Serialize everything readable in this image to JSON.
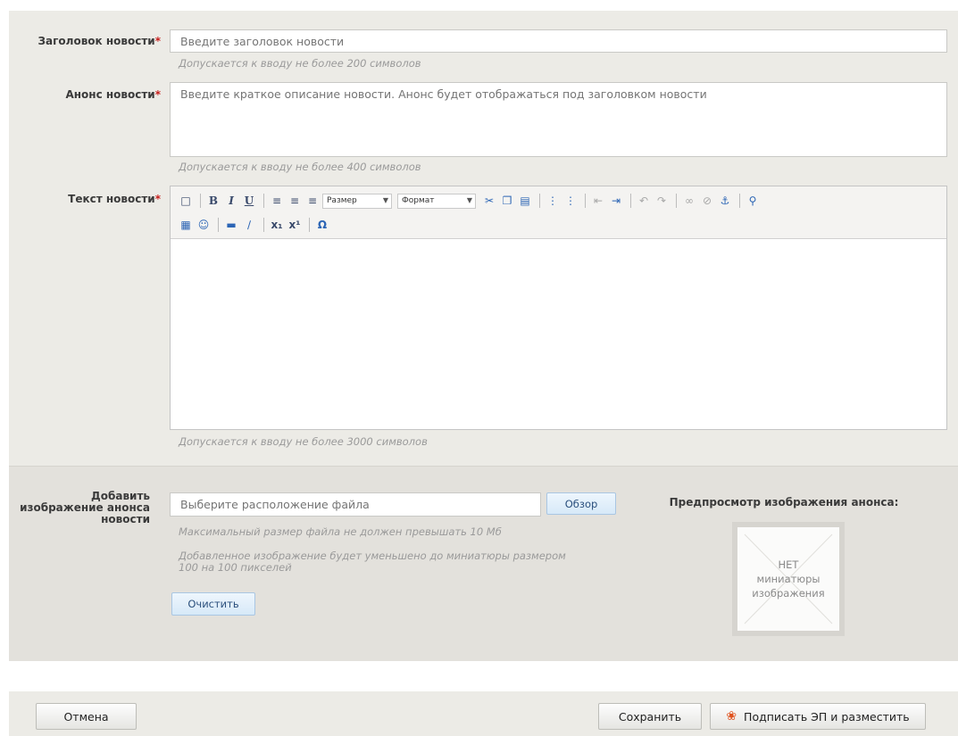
{
  "form": {
    "title_field": {
      "label": "Заголовок новости",
      "required_mark": "*",
      "placeholder": "Введите заголовок новости",
      "hint": "Допускается к вводу не более 200 символов"
    },
    "announce_field": {
      "label": "Анонс новости",
      "required_mark": "*",
      "placeholder": "Введите краткое описание новости. Анонс будет отображаться под заголовком новости",
      "hint": "Допускается к вводу не более 400 символов"
    },
    "text_field": {
      "label": "Текст новости",
      "required_mark": "*",
      "hint": "Допускается к вводу не более 3000 символов",
      "toolbar": {
        "size_select": "Размер",
        "format_select": "Формат",
        "icons": [
          "new-document-icon",
          "bold-icon",
          "italic-icon",
          "underline-icon",
          "align-left-icon",
          "align-center-icon",
          "align-right-icon",
          "cut-icon",
          "copy-icon",
          "paste-icon",
          "bulleted-list-icon",
          "numbered-list-icon",
          "outdent-icon",
          "indent-icon",
          "undo-icon",
          "redo-icon",
          "link-icon",
          "unlink-icon",
          "anchor-icon",
          "find-icon",
          "table-icon",
          "smiley-icon",
          "horizontal-line-icon",
          "remove-format-icon",
          "subscript-icon",
          "superscript-icon",
          "special-char-icon"
        ]
      }
    },
    "image_field": {
      "label": "Добавить изображение анонса новости",
      "placeholder": "Выберите расположение файла",
      "browse_button": "Обзор",
      "hint_size": "Максимальный размер файла не должен превышать 10 Мб",
      "hint_resize": "Добавленное изображение будет уменьшено до миниатюры размером 100 на 100 пикселей",
      "clear_button": "Очистить",
      "preview_title": "Предпросмотр изображения анонса:",
      "preview_placeholder": "НЕТ миниатюры изображения",
      "preview_line1": "НЕТ",
      "preview_line2": "миниатюры",
      "preview_line3": "изображения"
    }
  },
  "footer": {
    "cancel_button": "Отмена",
    "save_button": "Сохранить",
    "sign_publish_button": "Подписать ЭП и разместить"
  }
}
